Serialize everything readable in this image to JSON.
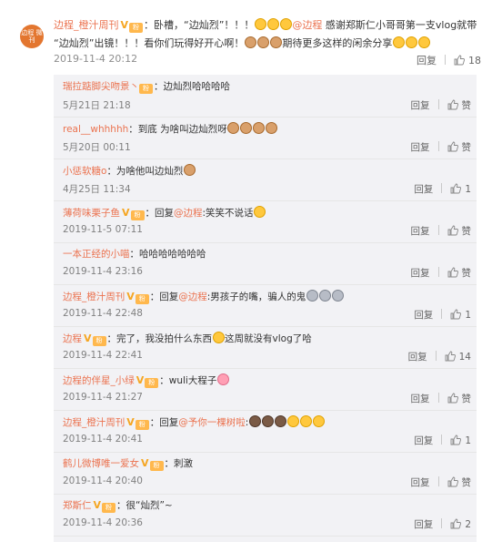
{
  "top_comment": {
    "avatar_text": "边程 微刊",
    "author": "边程_橙汁周刊",
    "badges": [
      "V",
      "粉"
    ],
    "text_prefix": "：卧槽，“边灿烈”！！！",
    "mention": "@边程",
    "text_middle": " 感谢郑斯仁小哥哥第一支vlog就带",
    "text_line2_a": "“边灿烈”出镜！！！看你们玩得好开心啊！",
    "text_line2_b": "期待更多这样的闲余分享",
    "time": "2019-11-4 20:12",
    "reply_label": "回复",
    "like_count": "18"
  },
  "replies": [
    {
      "author": "瑞拉踮脚尖吻景丶",
      "badges": [
        "粉"
      ],
      "text": "：边灿烈哈哈哈哈",
      "time": "5月21日 21:18",
      "reply_label": "回复",
      "like": "赞"
    },
    {
      "author": "real__whhhhh",
      "badges": [],
      "text": "：到底 为啥叫边灿烈呀",
      "time": "5月20日 00:11",
      "reply_label": "回复",
      "like": "赞"
    },
    {
      "author": "小惩软糖o",
      "badges": [],
      "text": "：为啥他叫边灿烈",
      "time": "4月25日 11:34",
      "reply_label": "回复",
      "like": "1"
    },
    {
      "author": "薄荷味栗子鱼",
      "badges": [
        "V",
        "粉"
      ],
      "text_a": "：回复",
      "mention": "@边程",
      "text": ":笑笑不说话",
      "time": "2019-11-5 07:11",
      "reply_label": "回复",
      "like": "赞"
    },
    {
      "author": "一本正经的小喵",
      "badges": [],
      "text": "：哈哈哈哈哈哈哈",
      "time": "2019-11-4 23:16",
      "reply_label": "回复",
      "like": "赞"
    },
    {
      "author": "边程_橙汁周刊",
      "badges": [
        "V",
        "粉"
      ],
      "text_a": "：回复",
      "mention": "@边程",
      "text": ":男孩子的嘴，骗人的鬼",
      "time": "2019-11-4 22:48",
      "reply_label": "回复",
      "like": "1"
    },
    {
      "author": "边程",
      "badges": [
        "V",
        "粉"
      ],
      "text": "：完了，我没拍什么东西",
      "text_b": "这周就没有vlog了哈",
      "time": "2019-11-4 22:41",
      "reply_label": "回复",
      "like": "14"
    },
    {
      "author": "边程的伴星_小绿",
      "badges": [
        "V",
        "粉"
      ],
      "text": "：wuli大程子",
      "time": "2019-11-4 21:27",
      "reply_label": "回复",
      "like": "赞"
    },
    {
      "author": "边程_橙汁周刊",
      "badges": [
        "V",
        "粉"
      ],
      "text_a": "：回复",
      "mention": "@予你一棵树啦",
      "text": ":",
      "time": "2019-11-4 20:41",
      "reply_label": "回复",
      "like": "1"
    },
    {
      "author": "鹤儿微博唯一爱女",
      "badges": [
        "V",
        "粉"
      ],
      "text": "：刺激",
      "time": "2019-11-4 20:40",
      "reply_label": "回复",
      "like": "赞"
    },
    {
      "author": "郑斯仁",
      "badges": [
        "V",
        "粉"
      ],
      "text": "：很“灿烈”~",
      "time": "2019-11-4 20:36",
      "reply_label": "回复",
      "like": "2"
    }
  ]
}
